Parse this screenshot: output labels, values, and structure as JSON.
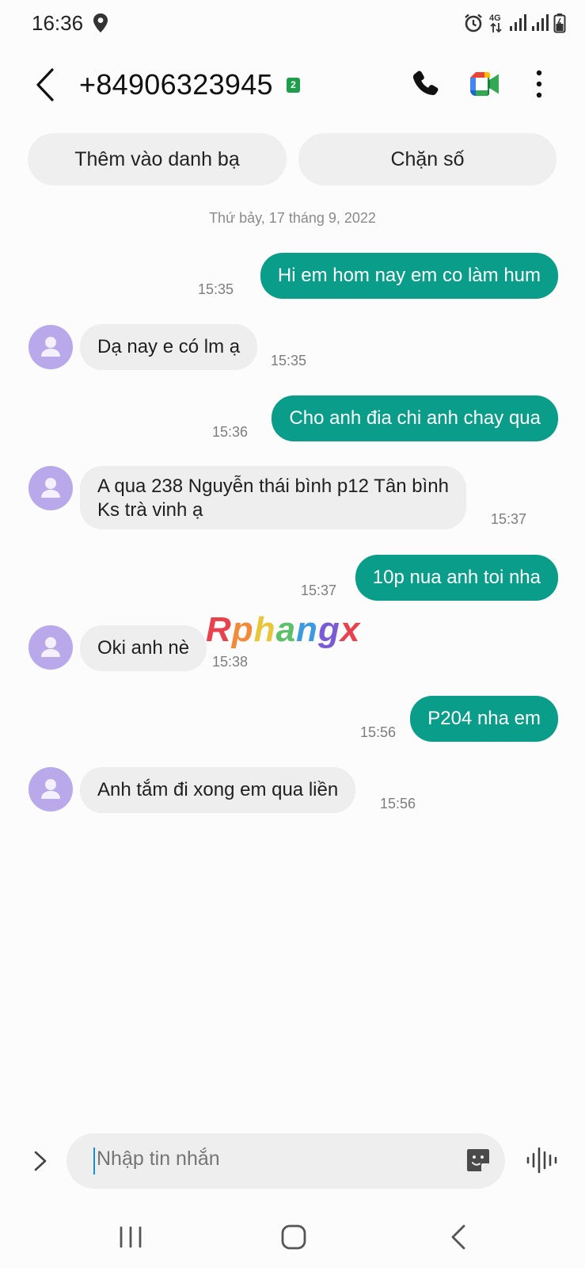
{
  "status_bar": {
    "time": "16:36",
    "network_label": "4G",
    "icons": [
      "location-icon",
      "alarm-icon",
      "signal-icon",
      "signal-icon",
      "battery-icon"
    ]
  },
  "header": {
    "contact_number": "+84906323945",
    "sim_badge": "2",
    "icons": [
      "back-icon",
      "phone-icon",
      "video-call-icon",
      "more-icon"
    ]
  },
  "actions": {
    "add_contact": "Thêm vào danh bạ",
    "block_number": "Chặn số"
  },
  "conversation": {
    "date": "Thứ bảy, 17 tháng 9, 2022",
    "messages": [
      {
        "direction": "out",
        "text": "Hi em hom nay em co làm hum",
        "time": "15:35"
      },
      {
        "direction": "in",
        "text": "Dạ nay e có lm ạ",
        "time": "15:35"
      },
      {
        "direction": "out",
        "text": "Cho anh đia chi anh chay qua",
        "time": "15:36"
      },
      {
        "direction": "in",
        "text_line1": "A qua 238 Nguyễn thái bình p12 Tân bình",
        "text_line2": "Ks trà vinh ạ",
        "time": "15:37"
      },
      {
        "direction": "out",
        "text": "10p nua anh toi nha",
        "time": "15:37"
      },
      {
        "direction": "in",
        "text": "Oki anh nè",
        "time": "15:38"
      },
      {
        "direction": "out",
        "text": "P204 nha em",
        "time": "15:56"
      },
      {
        "direction": "in",
        "text": "Anh tắm đi xong em qua liền",
        "time": "15:56"
      }
    ]
  },
  "watermark": {
    "text": "Rphangx",
    "colors": [
      "#e8424f",
      "#f28a3b",
      "#e9c53a",
      "#5cc06a",
      "#3c9be0",
      "#7a5bd6",
      "#e8424f"
    ]
  },
  "composer": {
    "placeholder": "Nhập tin nhắn",
    "value": ""
  },
  "nav_bar": {
    "icons": [
      "recents-icon",
      "home-icon",
      "nav-back-icon"
    ]
  },
  "colors": {
    "outgoing_bubble": "#0a9d8a",
    "incoming_bubble": "#eeeeee",
    "avatar": "#b9a9ea",
    "sim_badge": "#1d9e4a"
  }
}
